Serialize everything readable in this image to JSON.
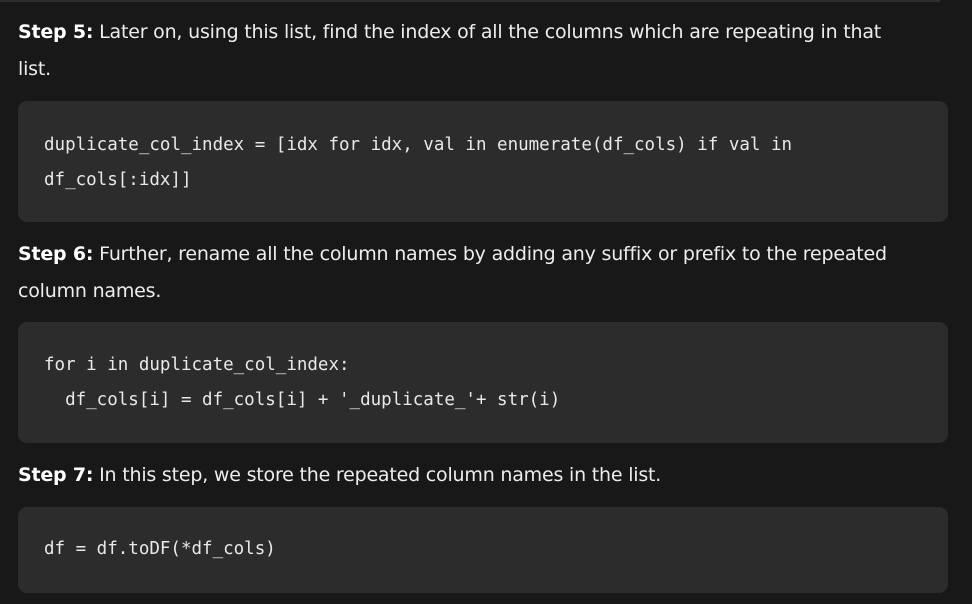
{
  "steps": [
    {
      "label": "Step 5:",
      "line1": " Later on, using this list, find the index of all the columns which are repeating in that",
      "line2": "list.",
      "code": [
        "duplicate_col_index = [idx for idx, val in enumerate(df_cols) if val in",
        "df_cols[:idx]]"
      ]
    },
    {
      "label": "Step 6:",
      "line1": " Further, rename all the column names by adding any suffix or prefix to the repeated",
      "line2": "column names.",
      "code": [
        "for i in duplicate_col_index:",
        "  df_cols[i] = df_cols[i] + '_duplicate_'+ str(i)"
      ]
    },
    {
      "label": "Step 7:",
      "line1": " In this step, we store the repeated column names in the list.",
      "code": [
        "df = df.toDF(*df_cols)"
      ]
    }
  ]
}
